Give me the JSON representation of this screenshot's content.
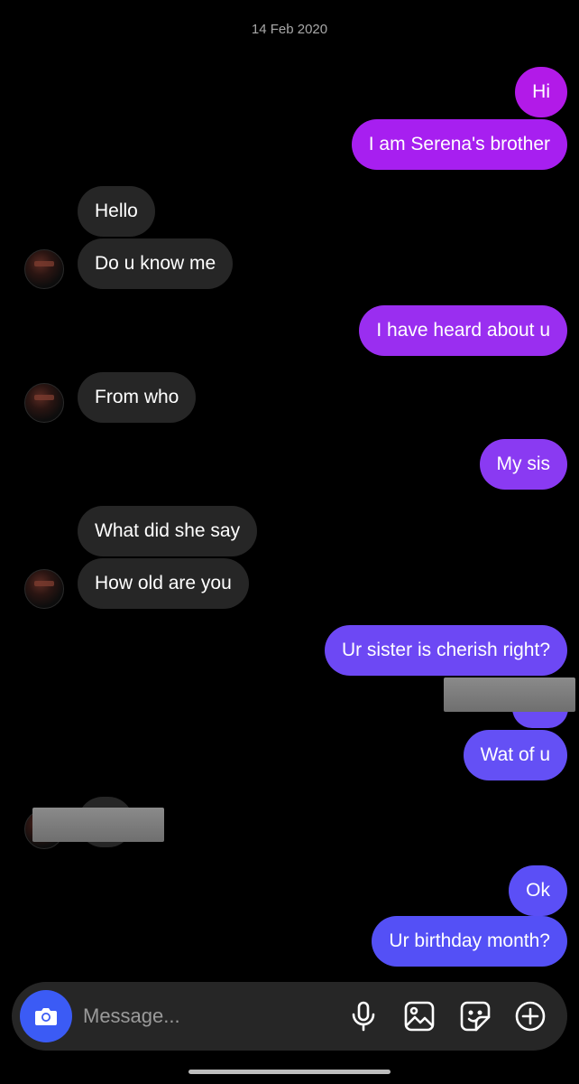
{
  "chat": {
    "date": "14 Feb 2020",
    "messages": [
      {
        "from": "me",
        "text": "Hi"
      },
      {
        "from": "me",
        "text": "I am Serena's brother"
      },
      {
        "from": "them",
        "text": "Hello"
      },
      {
        "from": "them",
        "text": "Do u know me"
      },
      {
        "from": "me",
        "text": "I have heard about u"
      },
      {
        "from": "them",
        "text": "From who"
      },
      {
        "from": "me",
        "text": "My sis"
      },
      {
        "from": "them",
        "text": "What did she say"
      },
      {
        "from": "them",
        "text": "How old are you"
      },
      {
        "from": "me",
        "text": "Ur sister is cherish right?"
      },
      {
        "from": "me",
        "text": "Wat of u"
      },
      {
        "from": "me",
        "text": "Ok"
      },
      {
        "from": "me",
        "text": "Ur birthday month?"
      }
    ]
  },
  "colors": {
    "outgoing_top": "#a71ff0",
    "outgoing_mid": "#8a3af2",
    "outgoing_bottom": "#5b4ff6",
    "incoming": "#262626",
    "camera_button": "#3b5bf5"
  },
  "composer": {
    "placeholder": "Message...",
    "icons": [
      "camera-icon",
      "microphone-icon",
      "gallery-icon",
      "sticker-icon",
      "plus-icon"
    ]
  }
}
